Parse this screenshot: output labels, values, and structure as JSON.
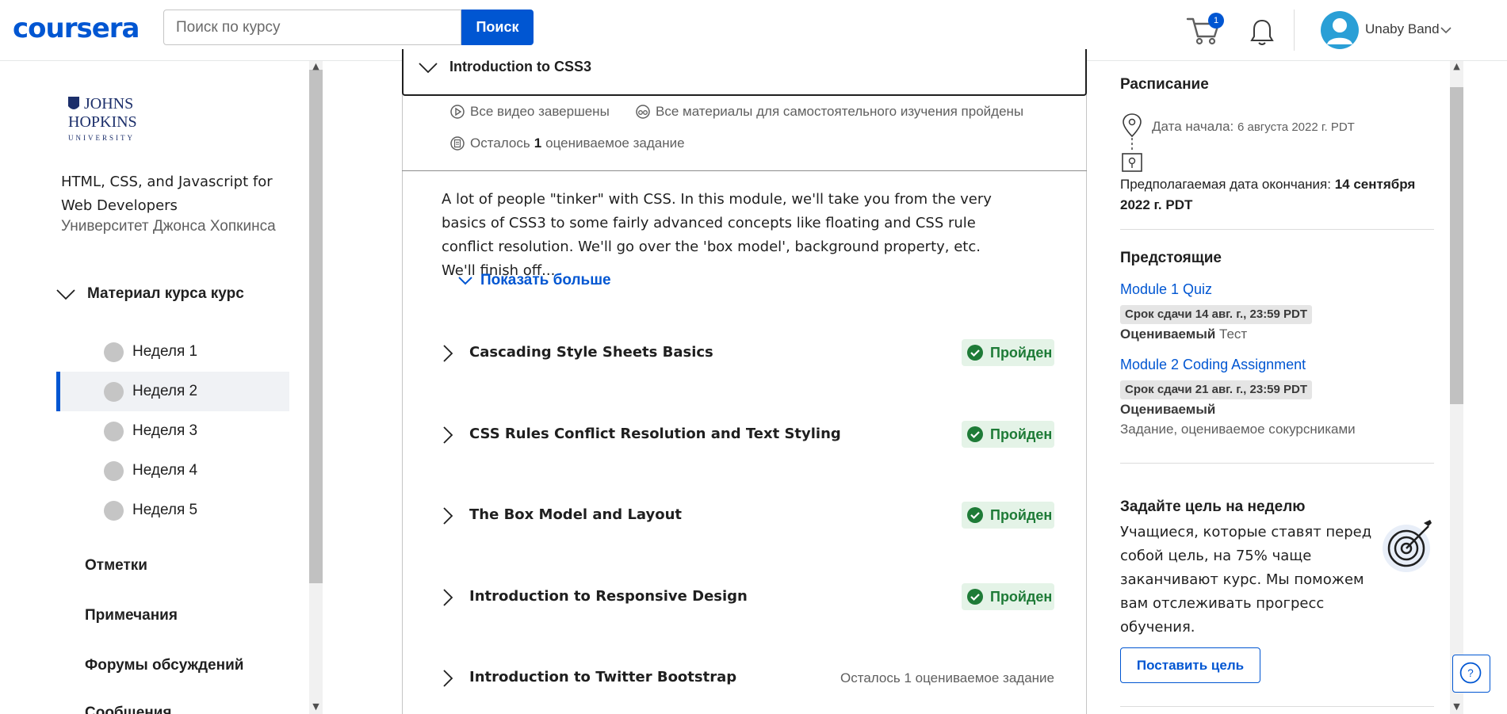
{
  "header": {
    "logo": "coursera",
    "search_placeholder": "Поиск по курсу",
    "search_button": "Поиск",
    "cart_count": "1",
    "user_name": "Unaby Band"
  },
  "sidebar": {
    "university_logo_text": "JOHNS HOPKINS UNIVERSITY",
    "course_title": "HTML, CSS, and Javascript for Web Developers",
    "university": "Университет Джонса Хопкинса",
    "material_header": "Материал курса курс",
    "weeks": [
      "Неделя 1",
      "Неделя 2",
      "Неделя 3",
      "Неделя 4",
      "Неделя 5"
    ],
    "active_week": "Неделя 2",
    "links": [
      "Отметки",
      "Примечания",
      "Форумы обсуждений",
      "Сообщения"
    ]
  },
  "main": {
    "module_title": "Introduction to CSS3",
    "stats": {
      "videos": "Все видео завершены",
      "readings": "Все материалы для самостоятельного изучения пройдены",
      "remaining_prefix": "Осталось",
      "remaining_count": "1",
      "remaining_suffix": "оцениваемое задание"
    },
    "description": "A lot of people \"tinker\" with CSS. In this module, we'll take you from the very basics of CSS3 to some fairly advanced concepts like floating and CSS rule conflict resolution. We'll go over the 'box model', background property, etc. We'll finish off...",
    "show_more": "Показать больше",
    "lessons": [
      {
        "title": "Cascading Style Sheets Basics",
        "status": "Пройден"
      },
      {
        "title": "CSS Rules Conflict Resolution and Text Styling",
        "status": "Пройден"
      },
      {
        "title": "The Box Model and Layout",
        "status": "Пройден"
      },
      {
        "title": "Introduction to Responsive Design",
        "status": "Пройден"
      },
      {
        "title": "Introduction to Twitter Bootstrap",
        "status": "Осталось 1 оцениваемое задание"
      }
    ]
  },
  "right_panel": {
    "schedule_title": "Расписание",
    "start_label": "Дата начала:",
    "start_value": "6 августа 2022 г. PDT",
    "end_label": "Предполагаемая дата окончания:",
    "end_value": "14 сентября 2022 г. PDT",
    "upcoming_title": "Предстоящие",
    "upcoming": [
      {
        "title": "Module 1 Quiz",
        "due": "Срок сдачи 14 авг. г., 23:59 PDT",
        "graded": "Оцениваемый",
        "type": "Тест"
      },
      {
        "title": "Module 2 Coding Assignment",
        "due": "Срок сдачи 21 авг. г., 23:59 PDT",
        "graded": "Оцениваемый",
        "type": "Задание, оцениваемое сокурсниками"
      }
    ],
    "goal_title": "Задайте цель на неделю",
    "goal_text": "Учащиеся, которые ставят перед собой цель, на 75% чаще заканчивают курс. Мы поможем вам отслеживать прогресс обучения.",
    "goal_button": "Поставить цель"
  },
  "colors": {
    "brand": "#0056d2",
    "success": "#1e7b37",
    "success_bg": "#e4f3e7"
  }
}
